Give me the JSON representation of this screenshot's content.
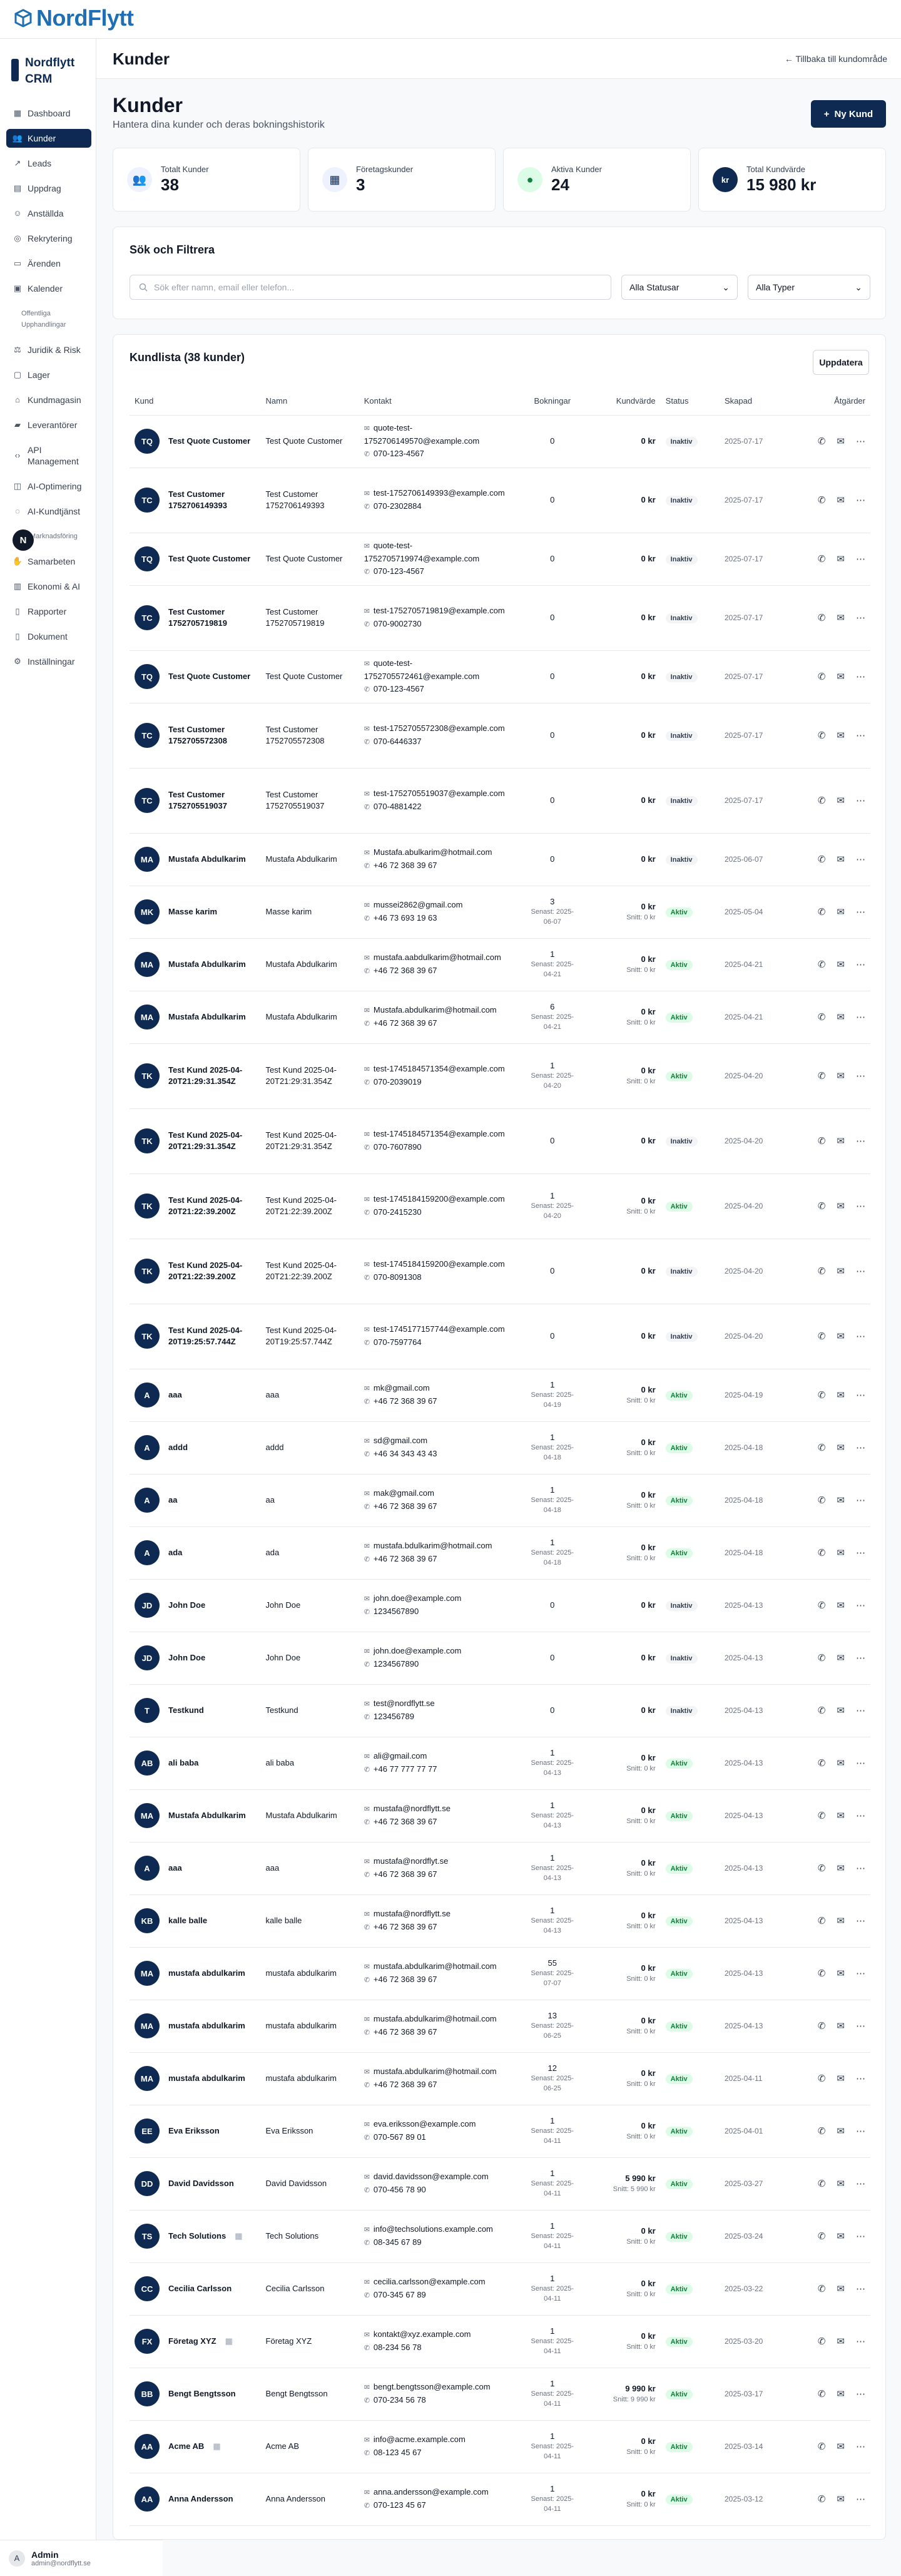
{
  "app": {
    "logo": "NordFlytt",
    "brand": "Nordflytt CRM"
  },
  "sidebar": {
    "items": [
      {
        "label": "Dashboard",
        "icon": "grid-icon"
      },
      {
        "label": "Kunder",
        "icon": "users-icon",
        "active": true
      },
      {
        "label": "Leads",
        "icon": "trend-icon"
      },
      {
        "label": "Uppdrag",
        "icon": "clipboard-icon"
      },
      {
        "label": "Anställda",
        "icon": "user-icon"
      },
      {
        "label": "Rekrytering",
        "icon": "target-icon"
      },
      {
        "label": "Ärenden",
        "icon": "ticket-icon"
      },
      {
        "label": "Kalender",
        "icon": "calendar-icon"
      },
      {
        "label": "Offentliga Upphandlingar",
        "icon": "",
        "sub": true
      },
      {
        "label": "Juridik & Risk",
        "icon": "scale-icon"
      },
      {
        "label": "Lager",
        "icon": "box-icon"
      },
      {
        "label": "Kundmagasin",
        "icon": "store-icon"
      },
      {
        "label": "Leverantörer",
        "icon": "truck-icon"
      },
      {
        "label": "API Management",
        "icon": "code-icon"
      },
      {
        "label": "AI-Optimering",
        "icon": "cpu-icon"
      },
      {
        "label": "AI-Kundtjänst",
        "icon": "chat-icon"
      },
      {
        "label": "AI-Marknadsföring",
        "icon": "",
        "sub": true
      },
      {
        "label": "Samarbeten",
        "icon": "handshake-icon"
      },
      {
        "label": "Ekonomi & AI",
        "icon": "chart-icon"
      },
      {
        "label": "Rapporter",
        "icon": "file-icon"
      },
      {
        "label": "Dokument",
        "icon": "doc-icon"
      },
      {
        "label": "Inställningar",
        "icon": "gear-icon"
      }
    ],
    "fab": "N"
  },
  "user": {
    "initial": "A",
    "name": "Admin",
    "email": "admin@nordflytt.se"
  },
  "header": {
    "title": "Kunder",
    "back": "← Tillbaka till kundområde"
  },
  "page": {
    "title": "Kunder",
    "subtitle": "Hantera dina kunder och deras bokningshistorik",
    "new_button": "Ny Kund"
  },
  "stats": [
    {
      "label": "Totalt Kunder",
      "value": "38",
      "icon": "users-icon",
      "bg": "#eef2ff",
      "fg": "#0f2a52"
    },
    {
      "label": "Företagskunder",
      "value": "3",
      "icon": "building-icon",
      "bg": "#eef2ff",
      "fg": "#0f2a52"
    },
    {
      "label": "Aktiva Kunder",
      "value": "24",
      "icon": "dot-icon",
      "bg": "#dcfce7",
      "fg": "#15803d"
    },
    {
      "label": "Total Kundvärde",
      "value": "15 980 kr",
      "icon": "kr-icon",
      "bg": "#0f2a52",
      "fg": "#ffffff"
    }
  ],
  "filters": {
    "title": "Sök och Filtrera",
    "search_placeholder": "Sök efter namn, email eller telefon...",
    "status": "Alla Statusar",
    "type": "Alla Typer"
  },
  "list": {
    "title": "Kundlista (38 kunder)",
    "refresh": "Uppdatera",
    "columns": [
      "Kund",
      "Namn",
      "Kontakt",
      "Bokningar",
      "Kundvärde",
      "Status",
      "Skapad",
      "Åtgärder"
    ],
    "rows": [
      {
        "i": "TQ",
        "k": "Test Quote Customer",
        "n": "Test Quote Customer",
        "e": "quote-test-1752706149570@example.com",
        "p": "070-123-4567",
        "b": "0",
        "bs": "",
        "v": "0 kr",
        "vs": "",
        "s": "Inaktiv",
        "d": "2025-07-17"
      },
      {
        "i": "TC",
        "k": "Test Customer 1752706149393",
        "n": "Test Customer 1752706149393",
        "e": "test-1752706149393@example.com",
        "p": "070-2302884",
        "b": "0",
        "bs": "",
        "v": "0 kr",
        "vs": "",
        "s": "Inaktiv",
        "d": "2025-07-17"
      },
      {
        "i": "TQ",
        "k": "Test Quote Customer",
        "n": "Test Quote Customer",
        "e": "quote-test-1752705719974@example.com",
        "p": "070-123-4567",
        "b": "0",
        "bs": "",
        "v": "0 kr",
        "vs": "",
        "s": "Inaktiv",
        "d": "2025-07-17"
      },
      {
        "i": "TC",
        "k": "Test Customer 1752705719819",
        "n": "Test Customer 1752705719819",
        "e": "test-1752705719819@example.com",
        "p": "070-9002730",
        "b": "0",
        "bs": "",
        "v": "0 kr",
        "vs": "",
        "s": "Inaktiv",
        "d": "2025-07-17"
      },
      {
        "i": "TQ",
        "k": "Test Quote Customer",
        "n": "Test Quote Customer",
        "e": "quote-test-1752705572461@example.com",
        "p": "070-123-4567",
        "b": "0",
        "bs": "",
        "v": "0 kr",
        "vs": "",
        "s": "Inaktiv",
        "d": "2025-07-17"
      },
      {
        "i": "TC",
        "k": "Test Customer 1752705572308",
        "n": "Test Customer 1752705572308",
        "e": "test-1752705572308@example.com",
        "p": "070-6446337",
        "b": "0",
        "bs": "",
        "v": "0 kr",
        "vs": "",
        "s": "Inaktiv",
        "d": "2025-07-17"
      },
      {
        "i": "TC",
        "k": "Test Customer 1752705519037",
        "n": "Test Customer 1752705519037",
        "e": "test-1752705519037@example.com",
        "p": "070-4881422",
        "b": "0",
        "bs": "",
        "v": "0 kr",
        "vs": "",
        "s": "Inaktiv",
        "d": "2025-07-17"
      },
      {
        "i": "MA",
        "k": "Mustafa Abdulkarim",
        "n": "Mustafa Abdulkarim",
        "e": "Mustafa.abulkarim@hotmail.com",
        "p": "+46 72 368 39 67",
        "b": "0",
        "bs": "",
        "v": "0 kr",
        "vs": "",
        "s": "Inaktiv",
        "d": "2025-06-07"
      },
      {
        "i": "MK",
        "k": "Masse karim",
        "n": "Masse karim",
        "e": "mussei2862@gmail.com",
        "p": "+46 73 693 19 63",
        "b": "3",
        "bs": "Senast: 2025-06-07",
        "v": "0 kr",
        "vs": "Snitt: 0 kr",
        "s": "Aktiv",
        "d": "2025-05-04"
      },
      {
        "i": "MA",
        "k": "Mustafa Abdulkarim",
        "n": "Mustafa Abdulkarim",
        "e": "mustafa.aabdulkarim@hotmail.com",
        "p": "+46 72 368 39 67",
        "b": "1",
        "bs": "Senast: 2025-04-21",
        "v": "0 kr",
        "vs": "Snitt: 0 kr",
        "s": "Aktiv",
        "d": "2025-04-21"
      },
      {
        "i": "MA",
        "k": "Mustafa Abdulkarim",
        "n": "Mustafa Abdulkarim",
        "e": "Mustafa.abdulkarim@hotmail.com",
        "p": "+46 72 368 39 67",
        "b": "6",
        "bs": "Senast: 2025-04-21",
        "v": "0 kr",
        "vs": "Snitt: 0 kr",
        "s": "Aktiv",
        "d": "2025-04-21"
      },
      {
        "i": "TK",
        "k": "Test Kund 2025-04-20T21:29:31.354Z",
        "n": "Test Kund 2025-04-20T21:29:31.354Z",
        "e": "test-1745184571354@example.com",
        "p": "070-2039019",
        "b": "1",
        "bs": "Senast: 2025-04-20",
        "v": "0 kr",
        "vs": "Snitt: 0 kr",
        "s": "Aktiv",
        "d": "2025-04-20"
      },
      {
        "i": "TK",
        "k": "Test Kund 2025-04-20T21:29:31.354Z",
        "n": "Test Kund 2025-04-20T21:29:31.354Z",
        "e": "test-1745184571354@example.com",
        "p": "070-7607890",
        "b": "0",
        "bs": "",
        "v": "0 kr",
        "vs": "",
        "s": "Inaktiv",
        "d": "2025-04-20"
      },
      {
        "i": "TK",
        "k": "Test Kund 2025-04-20T21:22:39.200Z",
        "n": "Test Kund 2025-04-20T21:22:39.200Z",
        "e": "test-1745184159200@example.com",
        "p": "070-2415230",
        "b": "1",
        "bs": "Senast: 2025-04-20",
        "v": "0 kr",
        "vs": "Snitt: 0 kr",
        "s": "Aktiv",
        "d": "2025-04-20"
      },
      {
        "i": "TK",
        "k": "Test Kund 2025-04-20T21:22:39.200Z",
        "n": "Test Kund 2025-04-20T21:22:39.200Z",
        "e": "test-1745184159200@example.com",
        "p": "070-8091308",
        "b": "0",
        "bs": "",
        "v": "0 kr",
        "vs": "",
        "s": "Inaktiv",
        "d": "2025-04-20"
      },
      {
        "i": "TK",
        "k": "Test Kund 2025-04-20T19:25:57.744Z",
        "n": "Test Kund 2025-04-20T19:25:57.744Z",
        "e": "test-1745177157744@example.com",
        "p": "070-7597764",
        "b": "0",
        "bs": "",
        "v": "0 kr",
        "vs": "",
        "s": "Inaktiv",
        "d": "2025-04-20"
      },
      {
        "i": "A",
        "k": "aaa",
        "n": "aaa",
        "e": "mk@gmail.com",
        "p": "+46 72 368 39 67",
        "b": "1",
        "bs": "Senast: 2025-04-19",
        "v": "0 kr",
        "vs": "Snitt: 0 kr",
        "s": "Aktiv",
        "d": "2025-04-19"
      },
      {
        "i": "A",
        "k": "addd",
        "n": "addd",
        "e": "sd@gmail.com",
        "p": "+46 34 343 43 43",
        "b": "1",
        "bs": "Senast: 2025-04-18",
        "v": "0 kr",
        "vs": "Snitt: 0 kr",
        "s": "Aktiv",
        "d": "2025-04-18"
      },
      {
        "i": "A",
        "k": "aa",
        "n": "aa",
        "e": "mak@gmail.com",
        "p": "+46 72 368 39 67",
        "b": "1",
        "bs": "Senast: 2025-04-18",
        "v": "0 kr",
        "vs": "Snitt: 0 kr",
        "s": "Aktiv",
        "d": "2025-04-18"
      },
      {
        "i": "A",
        "k": "ada",
        "n": "ada",
        "e": "mustafa.bdulkarim@hotmail.com",
        "p": "+46 72 368 39 67",
        "b": "1",
        "bs": "Senast: 2025-04-18",
        "v": "0 kr",
        "vs": "Snitt: 0 kr",
        "s": "Aktiv",
        "d": "2025-04-18"
      },
      {
        "i": "JD",
        "k": "John Doe",
        "n": "John Doe",
        "e": "john.doe@example.com",
        "p": "1234567890",
        "b": "0",
        "bs": "",
        "v": "0 kr",
        "vs": "",
        "s": "Inaktiv",
        "d": "2025-04-13"
      },
      {
        "i": "JD",
        "k": "John Doe",
        "n": "John Doe",
        "e": "john.doe@example.com",
        "p": "1234567890",
        "b": "0",
        "bs": "",
        "v": "0 kr",
        "vs": "",
        "s": "Inaktiv",
        "d": "2025-04-13"
      },
      {
        "i": "T",
        "k": "Testkund",
        "n": "Testkund",
        "e": "test@nordflytt.se",
        "p": "123456789",
        "b": "0",
        "bs": "",
        "v": "0 kr",
        "vs": "",
        "s": "Inaktiv",
        "d": "2025-04-13"
      },
      {
        "i": "AB",
        "k": "ali baba",
        "n": "ali baba",
        "e": "ali@gmail.com",
        "p": "+46 77 777 77 77",
        "b": "1",
        "bs": "Senast: 2025-04-13",
        "v": "0 kr",
        "vs": "Snitt: 0 kr",
        "s": "Aktiv",
        "d": "2025-04-13"
      },
      {
        "i": "MA",
        "k": "Mustafa Abdulkarim",
        "n": "Mustafa Abdulkarim",
        "e": "mustafa@nordflytt.se",
        "p": "+46 72 368 39 67",
        "b": "1",
        "bs": "Senast: 2025-04-13",
        "v": "0 kr",
        "vs": "Snitt: 0 kr",
        "s": "Aktiv",
        "d": "2025-04-13"
      },
      {
        "i": "A",
        "k": "aaa",
        "n": "aaa",
        "e": "mustafa@nordflyt.se",
        "p": "+46 72 368 39 67",
        "b": "1",
        "bs": "Senast: 2025-04-13",
        "v": "0 kr",
        "vs": "Snitt: 0 kr",
        "s": "Aktiv",
        "d": "2025-04-13"
      },
      {
        "i": "KB",
        "k": "kalle balle",
        "n": "kalle balle",
        "e": "mustafa@nordflytt.se",
        "p": "+46 72 368 39 67",
        "b": "1",
        "bs": "Senast: 2025-04-13",
        "v": "0 kr",
        "vs": "Snitt: 0 kr",
        "s": "Aktiv",
        "d": "2025-04-13"
      },
      {
        "i": "MA",
        "k": "mustafa abdulkarim",
        "n": "mustafa abdulkarim",
        "e": "mustafa.abdulkarim@hotmail.com",
        "p": "+46 72 368 39 67",
        "b": "55",
        "bs": "Senast: 2025-07-07",
        "v": "0 kr",
        "vs": "Snitt: 0 kr",
        "s": "Aktiv",
        "d": "2025-04-13"
      },
      {
        "i": "MA",
        "k": "mustafa abdulkarim",
        "n": "mustafa abdulkarim",
        "e": "mustafa.abdulkarim@hotmail.com",
        "p": "+46 72 368 39 67",
        "b": "13",
        "bs": "Senast: 2025-06-25",
        "v": "0 kr",
        "vs": "Snitt: 0 kr",
        "s": "Aktiv",
        "d": "2025-04-13"
      },
      {
        "i": "MA",
        "k": "mustafa abdulkarim",
        "n": "mustafa abdulkarim",
        "e": "mustafa.abdulkarim@hotmail.com",
        "p": "+46 72 368 39 67",
        "b": "12",
        "bs": "Senast: 2025-06-25",
        "v": "0 kr",
        "vs": "Snitt: 0 kr",
        "s": "Aktiv",
        "d": "2025-04-11"
      },
      {
        "i": "EE",
        "k": "Eva Eriksson",
        "n": "Eva Eriksson",
        "e": "eva.eriksson@example.com",
        "p": "070-567 89 01",
        "b": "1",
        "bs": "Senast: 2025-04-11",
        "v": "0 kr",
        "vs": "Snitt: 0 kr",
        "s": "Aktiv",
        "d": "2025-04-01"
      },
      {
        "i": "DD",
        "k": "David Davidsson",
        "n": "David Davidsson",
        "e": "david.davidsson@example.com",
        "p": "070-456 78 90",
        "b": "1",
        "bs": "Senast: 2025-04-11",
        "v": "5 990 kr",
        "vs": "Snitt: 5 990 kr",
        "s": "Aktiv",
        "d": "2025-03-27"
      },
      {
        "i": "TS",
        "k": "Tech Solutions",
        "n": "Tech Solutions",
        "e": "info@techsolutions.example.com",
        "p": "08-345 67 89",
        "b": "1",
        "bs": "Senast: 2025-04-11",
        "v": "0 kr",
        "vs": "Snitt: 0 kr",
        "s": "Aktiv",
        "d": "2025-03-24",
        "co": true
      },
      {
        "i": "CC",
        "k": "Cecilia Carlsson",
        "n": "Cecilia Carlsson",
        "e": "cecilia.carlsson@example.com",
        "p": "070-345 67 89",
        "b": "1",
        "bs": "Senast: 2025-04-11",
        "v": "0 kr",
        "vs": "Snitt: 0 kr",
        "s": "Aktiv",
        "d": "2025-03-22"
      },
      {
        "i": "FX",
        "k": "Företag XYZ",
        "n": "Företag XYZ",
        "e": "kontakt@xyz.example.com",
        "p": "08-234 56 78",
        "b": "1",
        "bs": "Senast: 2025-04-11",
        "v": "0 kr",
        "vs": "Snitt: 0 kr",
        "s": "Aktiv",
        "d": "2025-03-20",
        "co": true
      },
      {
        "i": "BB",
        "k": "Bengt Bengtsson",
        "n": "Bengt Bengtsson",
        "e": "bengt.bengtsson@example.com",
        "p": "070-234 56 78",
        "b": "1",
        "bs": "Senast: 2025-04-11",
        "v": "9 990 kr",
        "vs": "Snitt: 9 990 kr",
        "s": "Aktiv",
        "d": "2025-03-17"
      },
      {
        "i": "AA",
        "k": "Acme AB",
        "n": "Acme AB",
        "e": "info@acme.example.com",
        "p": "08-123 45 67",
        "b": "1",
        "bs": "Senast: 2025-04-11",
        "v": "0 kr",
        "vs": "Snitt: 0 kr",
        "s": "Aktiv",
        "d": "2025-03-14",
        "co": true
      },
      {
        "i": "AA",
        "k": "Anna Andersson",
        "n": "Anna Andersson",
        "e": "anna.andersson@example.com",
        "p": "070-123 45 67",
        "b": "1",
        "bs": "Senast: 2025-04-11",
        "v": "0 kr",
        "vs": "Snitt: 0 kr",
        "s": "Aktiv",
        "d": "2025-03-12"
      }
    ]
  }
}
